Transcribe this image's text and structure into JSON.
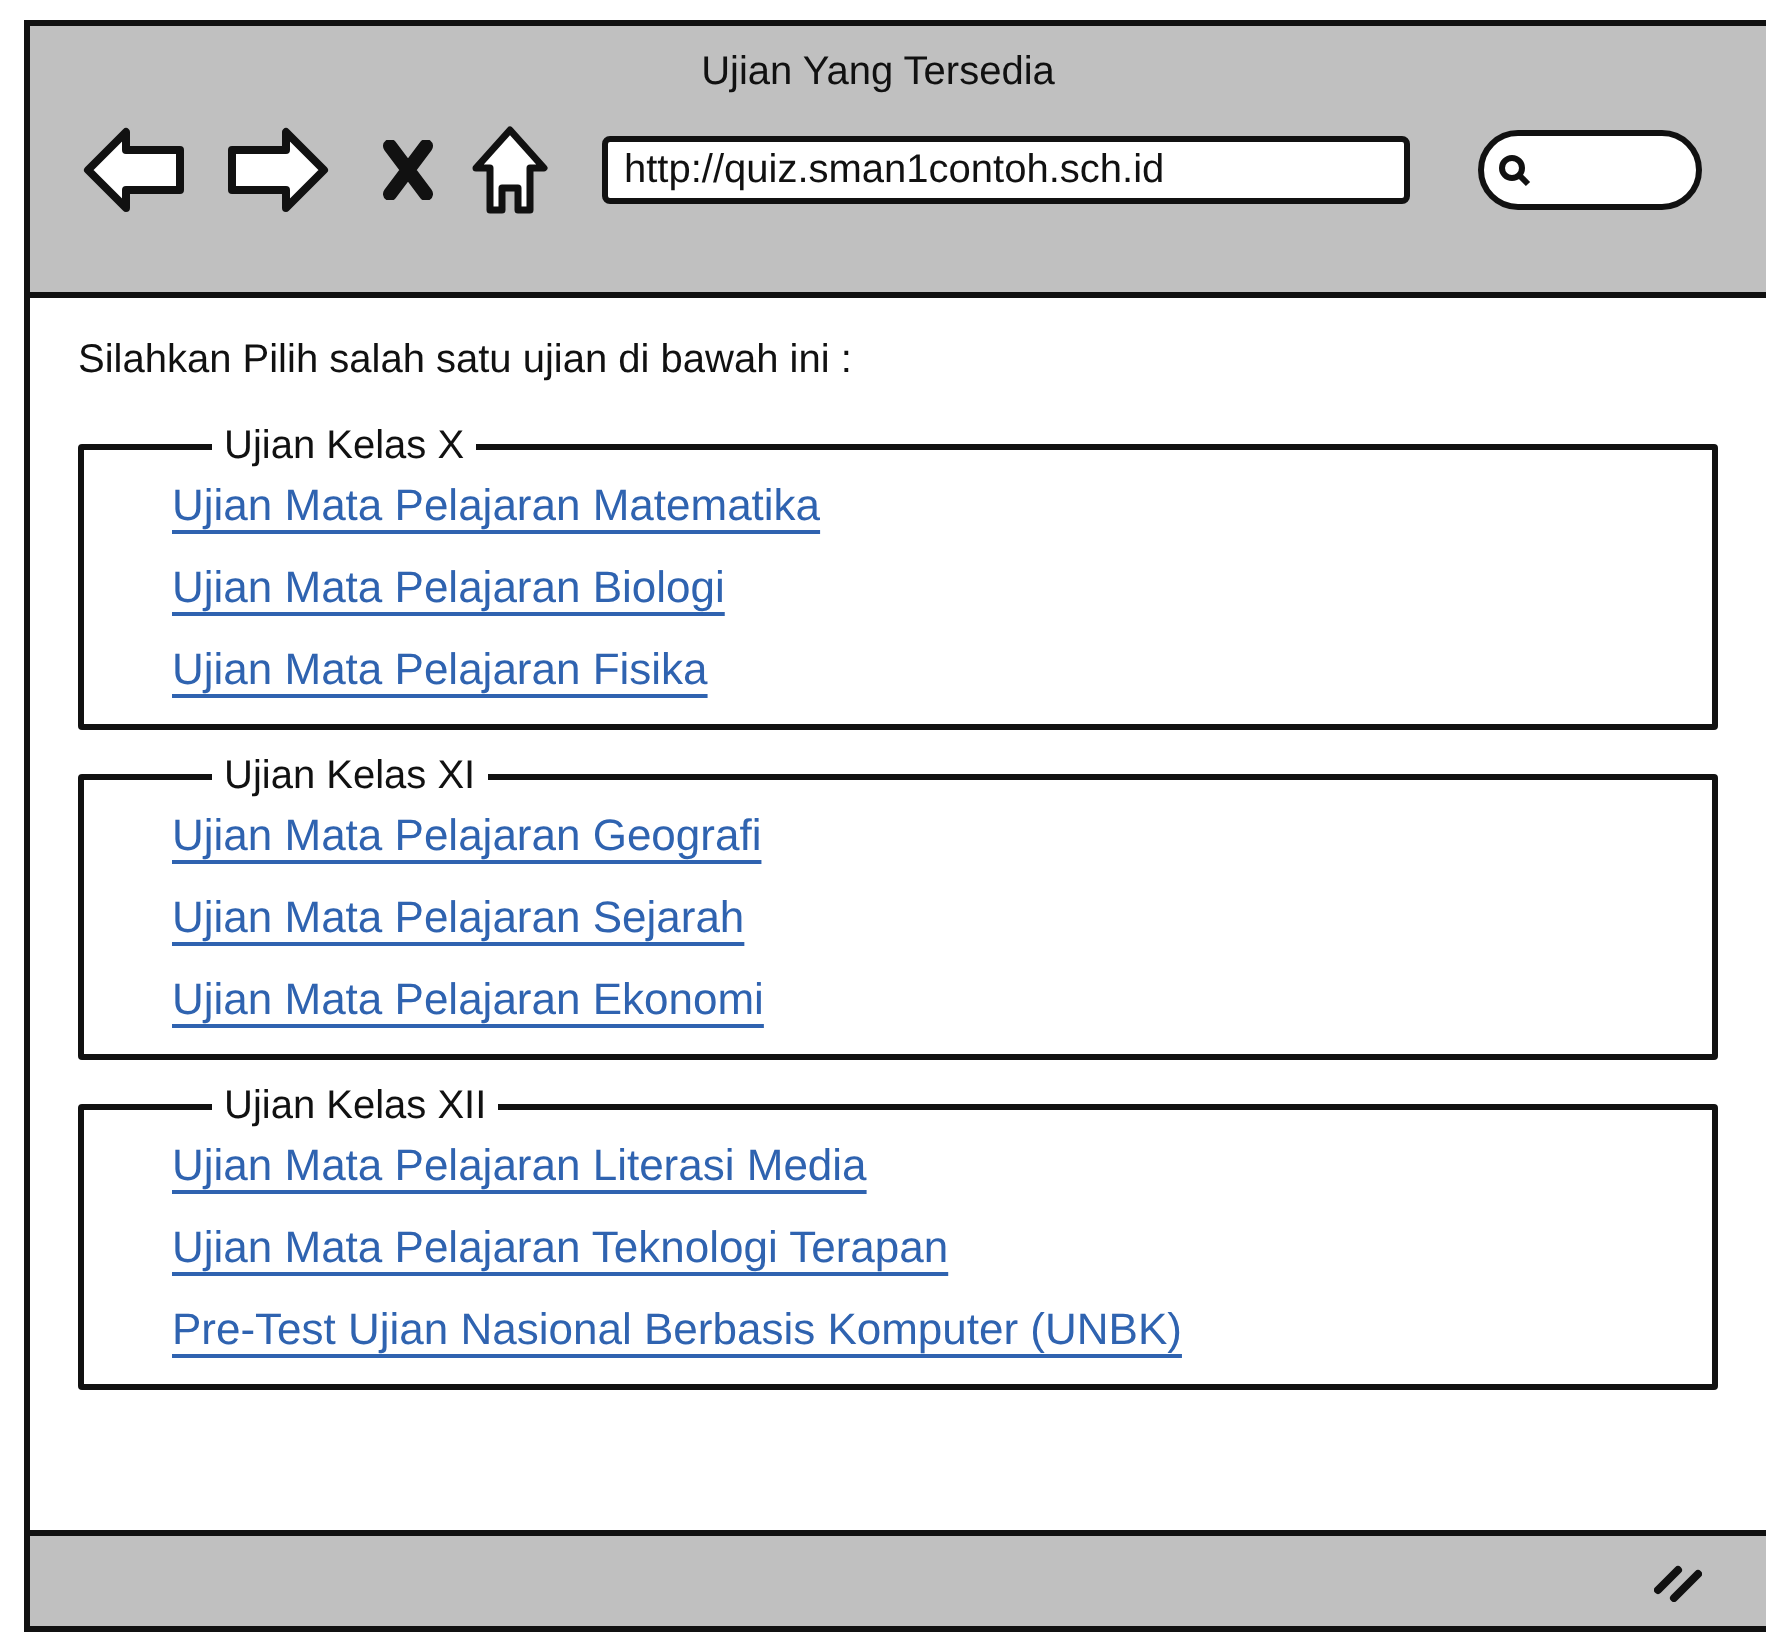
{
  "window": {
    "title": "Ujian Yang Tersedia"
  },
  "toolbar": {
    "url": "http://quiz.sman1contoh.sch.id"
  },
  "instruction": "Silahkan Pilih salah satu ujian di bawah ini :",
  "groups": [
    {
      "title": "Ujian Kelas X",
      "links": [
        "Ujian Mata Pelajaran Matematika",
        "Ujian Mata Pelajaran Biologi",
        "Ujian Mata Pelajaran Fisika"
      ]
    },
    {
      "title": "Ujian Kelas XI",
      "links": [
        "Ujian Mata Pelajaran Geografi",
        "Ujian Mata Pelajaran Sejarah",
        "Ujian Mata Pelajaran Ekonomi"
      ]
    },
    {
      "title": "Ujian Kelas XII",
      "links": [
        "Ujian Mata Pelajaran Literasi Media",
        "Ujian Mata Pelajaran Teknologi Terapan",
        "Pre-Test Ujian Nasional Berbasis Komputer (UNBK)"
      ]
    }
  ]
}
